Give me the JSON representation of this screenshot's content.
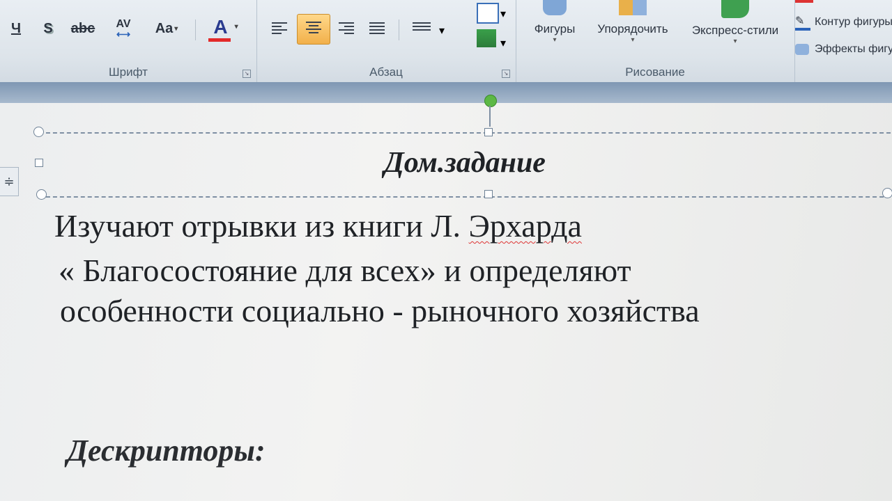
{
  "ribbon": {
    "font_group": {
      "label": "Шрифт",
      "underline_btn": "Ч",
      "shadow_btn": "S",
      "strike_btn": "abc",
      "spacing_btn": "AV",
      "case_btn": "Aa",
      "color_btn": "A"
    },
    "paragraph_group": {
      "label": "Абзац"
    },
    "drawing_group": {
      "label": "Рисование",
      "shapes": "Фигуры",
      "arrange": "Упорядочить",
      "quick_styles": "Экспресс-стили",
      "shape_outline": "Контур фигуры",
      "shape_effects": "Эффекты фигуры"
    }
  },
  "slide": {
    "title": "Дом.задание",
    "body_lines": [
      "Изучают отрывки из книги Л. ",
      "« Благосостояние для всех» и определяют",
      "особенности социально -  рыночного хозяйства"
    ],
    "misspelled_word": "Эрхарда",
    "descriptors_heading": "Дескрипторы:"
  },
  "colors": {
    "active_align": "#f2b04a",
    "font_color_bar": "#e32a2a",
    "rotate_handle": "#5cb845"
  }
}
